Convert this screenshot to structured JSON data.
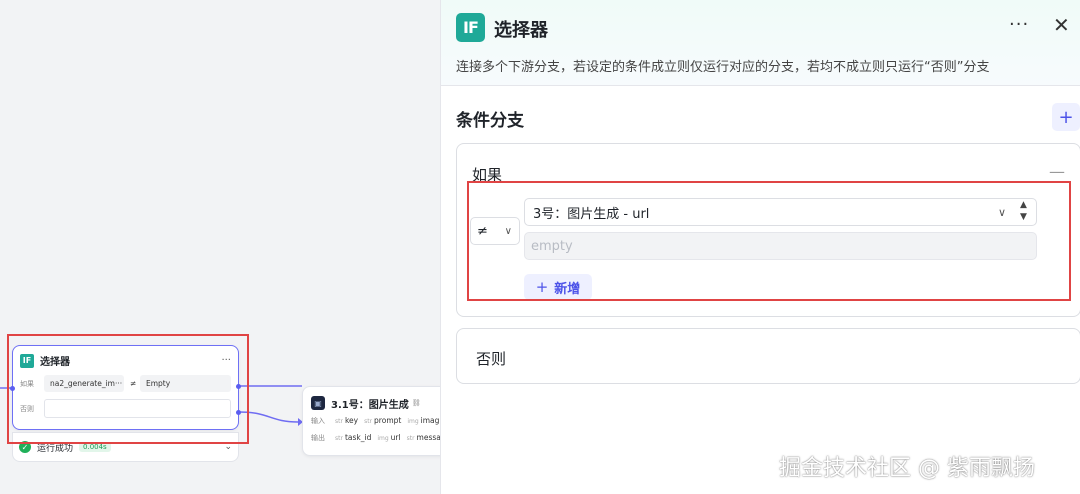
{
  "canvas": {
    "selector_node": {
      "icon": "IF",
      "title": "选择器",
      "more": "···",
      "if_label": "如果",
      "variable": "na2_generate_im···",
      "operator": "≠",
      "value": "Empty",
      "else_label": "否则"
    },
    "run_status": {
      "text": "运行成功",
      "time": "0.004s"
    },
    "image_node": {
      "title": "3.1号：图片生成",
      "input_label": "输入",
      "output_label": "输出",
      "inputs": [
        {
          "type": "str",
          "name": "key"
        },
        {
          "type": "str",
          "name": "prompt"
        },
        {
          "type": "img",
          "name": "imag"
        }
      ],
      "outputs": [
        {
          "type": "str",
          "name": "task_id"
        },
        {
          "type": "img",
          "name": "url"
        },
        {
          "type": "str",
          "name": "messa"
        }
      ]
    }
  },
  "panel": {
    "icon": "IF",
    "title": "选择器",
    "more": "···",
    "close": "✕",
    "description": "连接多个下游分支，若设定的条件成立则仅运行对应的分支，若均不成立则只运行“否则”分支",
    "section_title": "条件分支",
    "add_branch": "+",
    "if_card": {
      "label": "如果",
      "collapse": "—",
      "operator": "≠",
      "variable": "3号：图片生成 - url",
      "value_placeholder": "empty",
      "add_condition": "新增"
    },
    "else_card": {
      "label": "否则"
    }
  },
  "watermark": "掘金技术社区 @ 紫雨飘扬",
  "colors": {
    "accent": "#4d53e8",
    "if_icon": "#1fa998",
    "highlight": "#e04444",
    "success": "#20b05a"
  }
}
